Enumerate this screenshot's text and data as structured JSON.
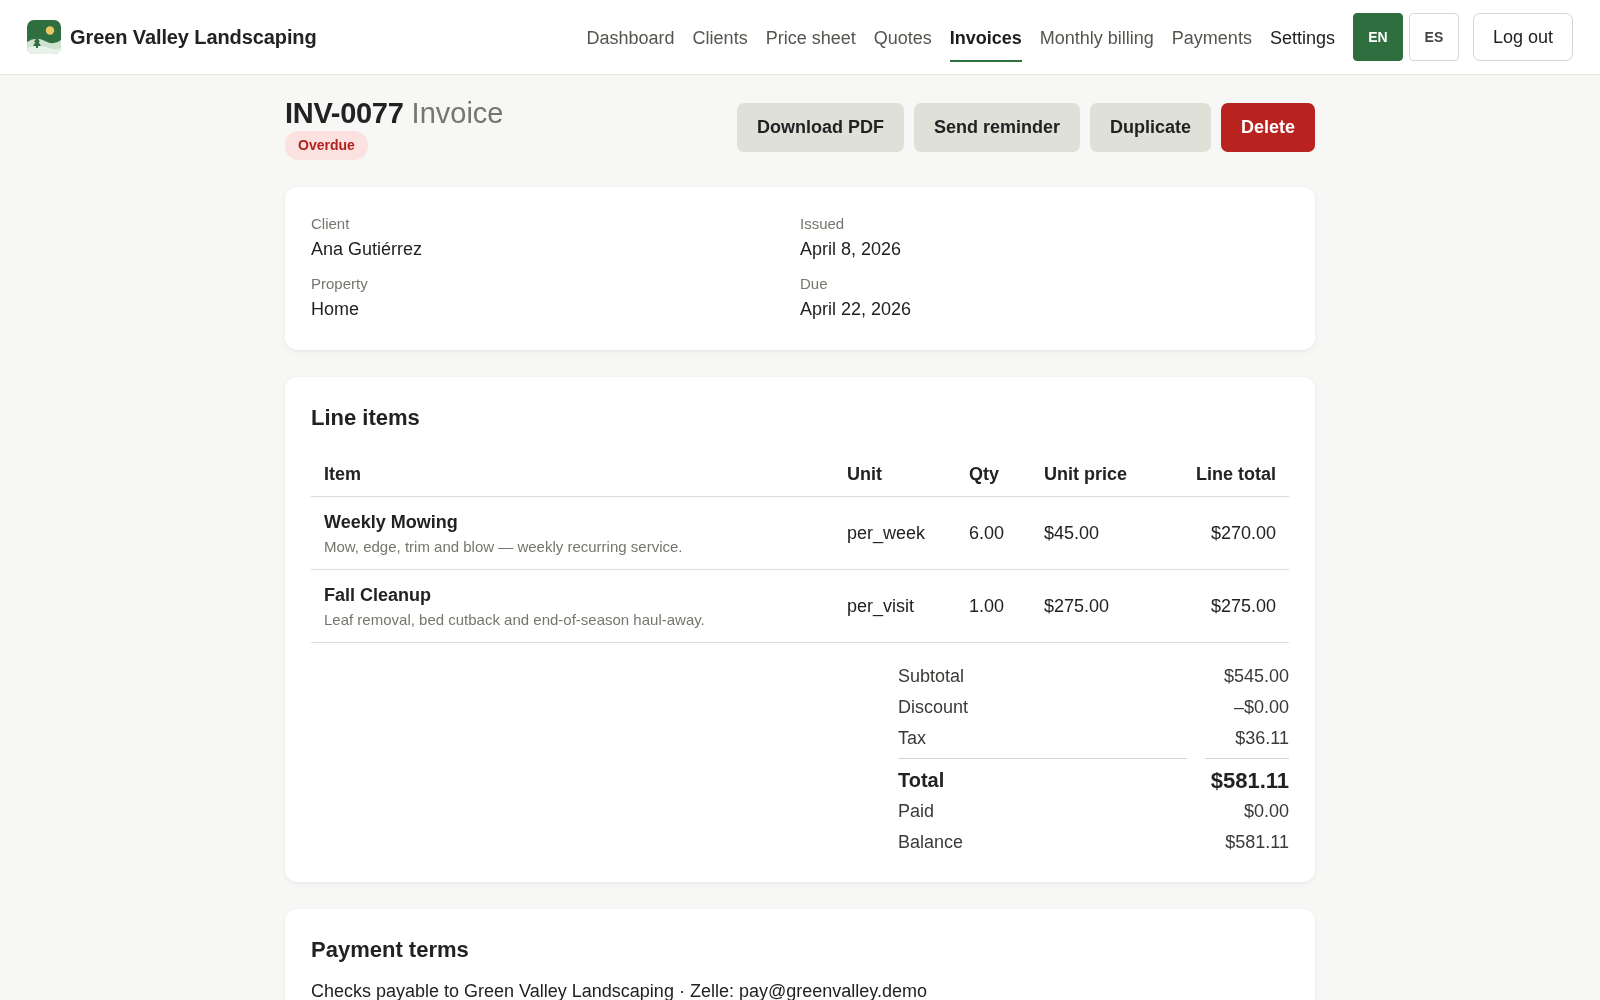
{
  "header": {
    "brand": "Green Valley Landscaping",
    "nav": [
      {
        "label": "Dashboard",
        "selected": false,
        "hovered": false
      },
      {
        "label": "Clients",
        "selected": false,
        "hovered": false
      },
      {
        "label": "Price sheet",
        "selected": false,
        "hovered": false
      },
      {
        "label": "Quotes",
        "selected": false,
        "hovered": false
      },
      {
        "label": "Invoices",
        "selected": true,
        "hovered": false
      },
      {
        "label": "Monthly billing",
        "selected": false,
        "hovered": false
      },
      {
        "label": "Payments",
        "selected": false,
        "hovered": false
      },
      {
        "label": "Settings",
        "selected": false,
        "hovered": true
      }
    ],
    "languages": [
      {
        "label": "EN",
        "selected": true
      },
      {
        "label": "ES",
        "selected": false
      }
    ],
    "logout": "Log out"
  },
  "invoice": {
    "number": "INV-0077",
    "title": "Invoice",
    "status": {
      "label": "Overdue",
      "kind": "overdue"
    },
    "actions": [
      {
        "label": "Download PDF",
        "kind": "secondary"
      },
      {
        "label": "Send reminder",
        "kind": "secondary"
      },
      {
        "label": "Duplicate",
        "kind": "secondary"
      },
      {
        "label": "Delete",
        "kind": "danger"
      }
    ]
  },
  "details": [
    {
      "label": "Client",
      "value": "Ana Gutiérrez"
    },
    {
      "label": "Issued",
      "value": "April 8, 2026"
    },
    {
      "label": "Property",
      "value": "Home"
    },
    {
      "label": "Due",
      "value": "April 22, 2026"
    }
  ],
  "line_items": {
    "title": "Line items",
    "columns": [
      "Item",
      "Unit",
      "Qty",
      "Unit price",
      "Line total"
    ],
    "rows": [
      {
        "item": "Weekly Mowing",
        "description": "Mow, edge, trim and blow — weekly recurring service.",
        "unit": "per_week",
        "qty": "6.00",
        "unit_price": "$45.00",
        "line_total": "$270.00"
      },
      {
        "item": "Fall Cleanup",
        "description": "Leaf removal, bed cutback and end-of-season haul-away.",
        "unit": "per_visit",
        "qty": "1.00",
        "unit_price": "$275.00",
        "line_total": "$275.00"
      }
    ],
    "totals": [
      {
        "label": "Subtotal",
        "value": "$545.00",
        "kind": "normal"
      },
      {
        "label": "Discount",
        "value": "–$0.00",
        "kind": "normal"
      },
      {
        "label": "Tax",
        "value": "$36.11",
        "kind": "normal"
      },
      {
        "label": "Total",
        "value": "$581.11",
        "kind": "grand"
      },
      {
        "label": "Paid",
        "value": "$0.00",
        "kind": "normal"
      },
      {
        "label": "Balance",
        "value": "$581.11",
        "kind": "normal"
      }
    ]
  },
  "payment_terms": {
    "title": "Payment terms",
    "text": "Checks payable to Green Valley Landscaping · Zelle: pay@greenvalley.demo"
  }
}
